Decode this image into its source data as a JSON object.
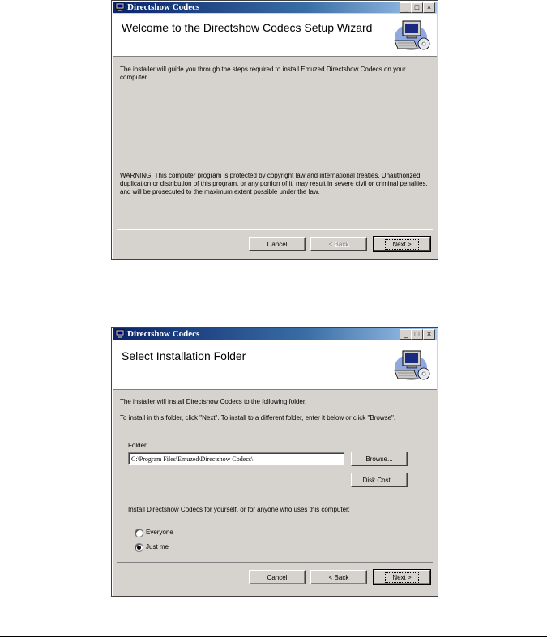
{
  "welcome_window": {
    "title": "Directshow Codecs",
    "heading": "Welcome to the Directshow Codecs Setup Wizard",
    "intro_text": "The installer will guide you through the steps required to install Emuzed Directshow Codecs on your computer.",
    "warning_text": "WARNING: This computer program is protected by copyright law and international treaties. Unauthorized duplication or distribution of this program, or any portion of it, may result in severe civil or criminal penalties, and will be prosecuted to the maximum extent possible under the law.",
    "buttons": {
      "cancel": "Cancel",
      "back": "< Back",
      "next": "Next >"
    }
  },
  "folder_window": {
    "title": "Directshow Codecs",
    "heading": "Select Installation Folder",
    "line1": "The installer will install Directshow Codecs to the following folder.",
    "line2": "To install in this folder, click \"Next\". To install to a different folder, enter it below or click \"Browse\".",
    "folder_label": "Folder:",
    "folder_value": "C:\\Program Files\\Emuzed\\Directshow Codecs\\",
    "browse_button": "Browse...",
    "disk_cost_button": "Disk Cost...",
    "install_for_text": "Install Directshow Codecs for yourself, or for anyone who uses this computer:",
    "radio_options": [
      {
        "label": "Everyone",
        "selected": false
      },
      {
        "label": "Just me",
        "selected": true
      }
    ],
    "buttons": {
      "cancel": "Cancel",
      "back": "< Back",
      "next": "Next >"
    }
  },
  "title_buttons": {
    "minimize": "_",
    "maximize": "□",
    "close": "×"
  },
  "colors": {
    "dialog_face": "#d6d3ce",
    "title_start": "#0a246a",
    "title_end": "#a6caf0"
  },
  "icons": [
    "installer-app-icon",
    "computer-setup-art"
  ]
}
